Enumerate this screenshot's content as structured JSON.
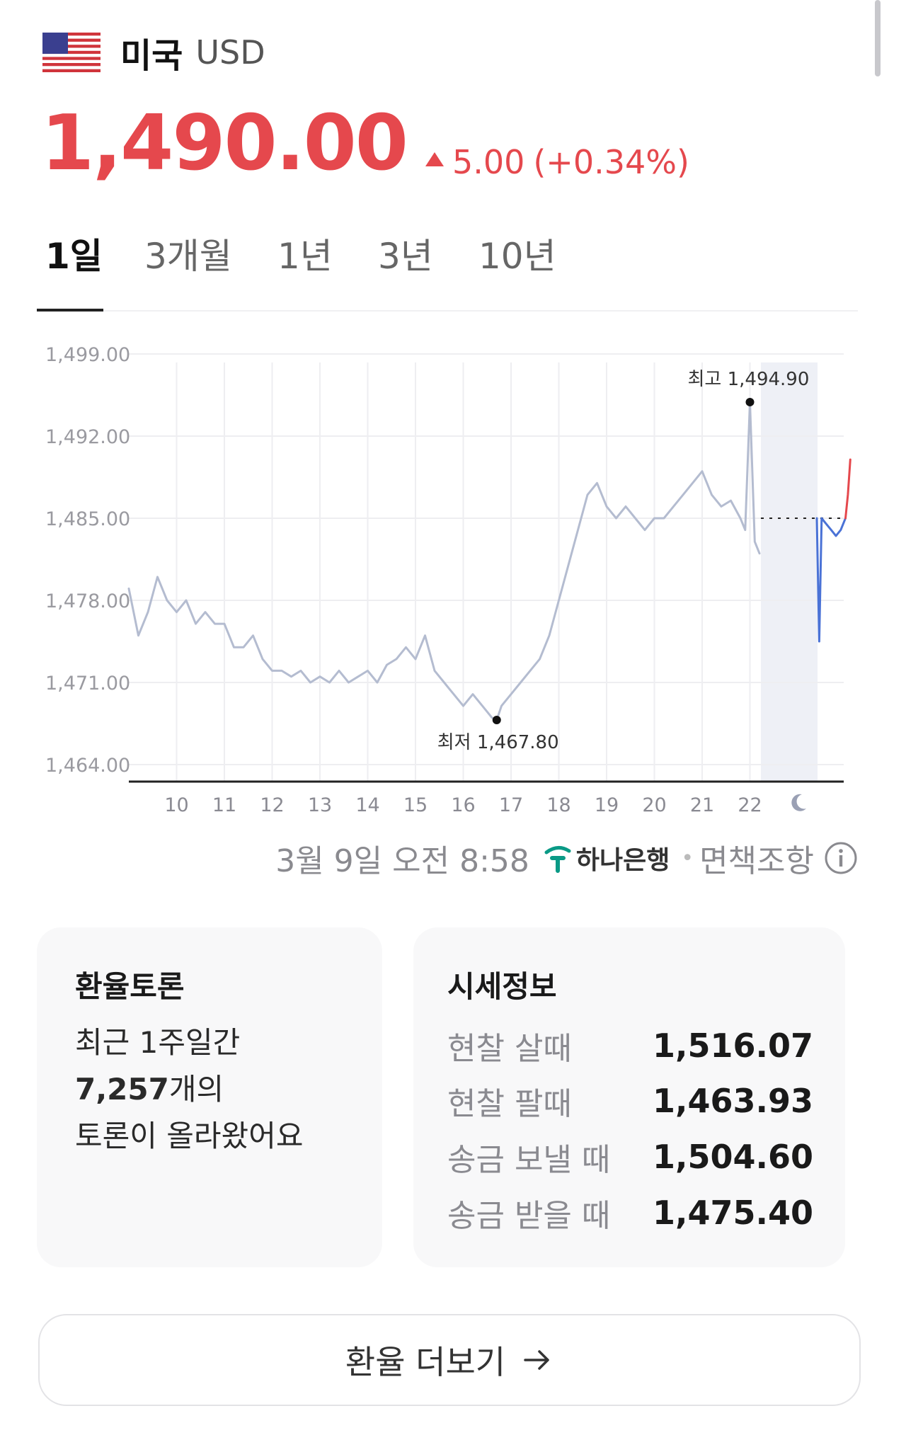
{
  "header": {
    "country": "미국",
    "code": "USD"
  },
  "price": {
    "value": "1,490.00",
    "change": "5.00",
    "change_pct": "(+0.34%)",
    "direction": "up",
    "color": "#e5484d"
  },
  "tabs": [
    {
      "label": "1일",
      "active": true
    },
    {
      "label": "3개월",
      "active": false
    },
    {
      "label": "1년",
      "active": false
    },
    {
      "label": "3년",
      "active": false
    },
    {
      "label": "10년",
      "active": false
    }
  ],
  "chart_data": {
    "type": "line",
    "ylim": [
      1464,
      1499
    ],
    "y_ticks": [
      "1,499.00",
      "1,492.00",
      "1,485.00",
      "1,478.00",
      "1,471.00",
      "1,464.00"
    ],
    "x_ticks": [
      "10",
      "11",
      "12",
      "13",
      "14",
      "15",
      "16",
      "17",
      "18",
      "19",
      "20",
      "21",
      "22"
    ],
    "night_icon": "moon-icon",
    "reference_value": 1485.0,
    "max": {
      "label": "최고 1,494.90",
      "value": 1494.9,
      "x": 22.0
    },
    "min": {
      "label": "최저 1,467.80",
      "value": 1467.8,
      "x": 16.7
    },
    "series": [
      {
        "color": "#b4bcd0",
        "x": [
          9.0,
          9.2,
          9.4,
          9.6,
          9.8,
          10.0,
          10.2,
          10.4,
          10.6,
          10.8,
          11.0,
          11.2,
          11.4,
          11.6,
          11.8,
          12.0,
          12.2,
          12.4,
          12.6,
          12.8,
          13.0,
          13.2,
          13.4,
          13.6,
          13.8,
          14.0,
          14.2,
          14.4,
          14.6,
          14.8,
          15.0,
          15.2,
          15.4,
          15.6,
          15.8,
          16.0,
          16.2,
          16.4,
          16.6,
          16.7,
          16.8,
          17.0,
          17.2,
          17.4,
          17.6,
          17.8,
          18.0,
          18.2,
          18.4,
          18.6,
          18.8,
          19.0,
          19.2,
          19.4,
          19.6,
          19.8,
          20.0,
          20.2,
          20.4,
          20.6,
          20.8,
          21.0,
          21.2,
          21.4,
          21.6,
          21.8,
          21.9,
          22.0,
          22.1,
          22.2
        ],
        "values": [
          1479,
          1475,
          1477,
          1480,
          1478,
          1477,
          1478,
          1476,
          1477,
          1476,
          1476,
          1474,
          1474,
          1475,
          1473,
          1472,
          1472,
          1471.5,
          1472,
          1471,
          1471.5,
          1471,
          1472,
          1471,
          1471.5,
          1472,
          1471,
          1472.5,
          1473,
          1474,
          1473,
          1475,
          1472,
          1471,
          1470,
          1469,
          1470,
          1469,
          1468,
          1467.8,
          1469,
          1470,
          1471,
          1472,
          1473,
          1475,
          1478,
          1481,
          1484,
          1487,
          1488,
          1486,
          1485,
          1486,
          1485,
          1484,
          1485,
          1485,
          1486,
          1487,
          1488,
          1489,
          1487,
          1486,
          1486.5,
          1485,
          1484,
          1494.9,
          1483,
          1482
        ]
      },
      {
        "color": "#4a72d6",
        "x": [
          23.4,
          23.45,
          23.5,
          23.6,
          23.7,
          23.8,
          23.9,
          24.0
        ],
        "values": [
          1485,
          1474.5,
          1485,
          1484.5,
          1484,
          1483.5,
          1484,
          1485
        ]
      },
      {
        "color": "#e5484d",
        "x": [
          24.0,
          24.05,
          24.1
        ],
        "values": [
          1485,
          1487,
          1490
        ]
      }
    ]
  },
  "source": {
    "time": "3월 9일 오전 8:58",
    "bank_name": "하나은행",
    "disclaimer": "면책조항"
  },
  "forum": {
    "title": "환율토론",
    "line1": "최근 1주일간",
    "count": "7,257",
    "count_suffix": "개의",
    "line3": "토론이 올라왔어요"
  },
  "rates": {
    "title": "시세정보",
    "rows": [
      {
        "label": "현찰 살때",
        "value": "1,516.07"
      },
      {
        "label": "현찰 팔때",
        "value": "1,463.93"
      },
      {
        "label": "송금 보낼 때",
        "value": "1,504.60"
      },
      {
        "label": "송금 받을 때",
        "value": "1,475.40"
      }
    ]
  },
  "more_button": {
    "label": "환율 더보기"
  }
}
